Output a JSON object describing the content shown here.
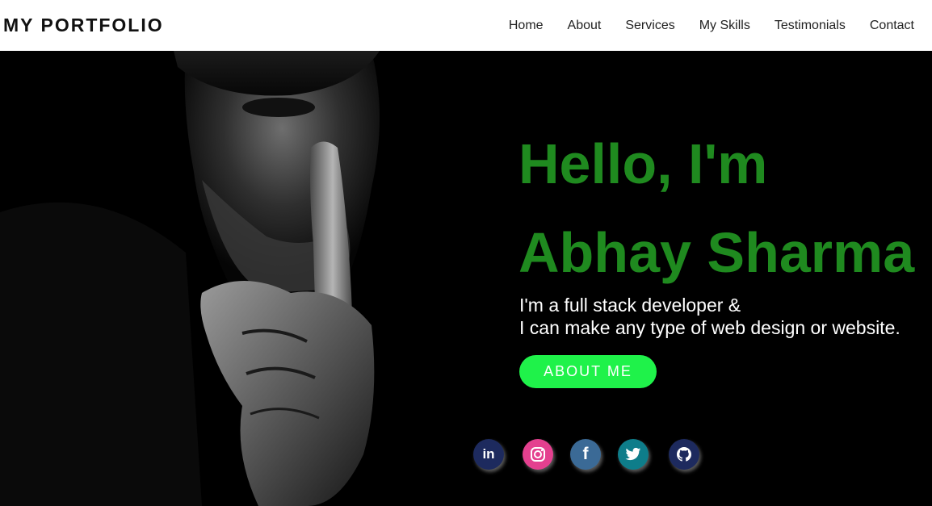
{
  "nav": {
    "brand": "MY PORTFOLIO",
    "links": [
      "Home",
      "About",
      "Services",
      "My Skills",
      "Testimonials",
      "Contact"
    ]
  },
  "hero": {
    "greeting": "Hello, I'm",
    "name": "Abhay Sharma",
    "tagline_line1": "I'm a full stack developer &",
    "tagline_line2": "I can make any type of web design or website.",
    "button_label": "ABOUT ME"
  },
  "social": [
    {
      "icon": "linkedin-icon",
      "glyph": "in",
      "color": "#1d2a5e"
    },
    {
      "icon": "instagram-icon",
      "color": "#e4408f"
    },
    {
      "icon": "facebook-icon",
      "glyph": "f",
      "color": "#3b6a96"
    },
    {
      "icon": "twitter-icon",
      "color": "#0e7d8a"
    },
    {
      "icon": "github-icon",
      "color": "#1d2a5e"
    }
  ],
  "colors": {
    "accent_green": "#1f8a1f",
    "button_green": "#1ff24a"
  }
}
